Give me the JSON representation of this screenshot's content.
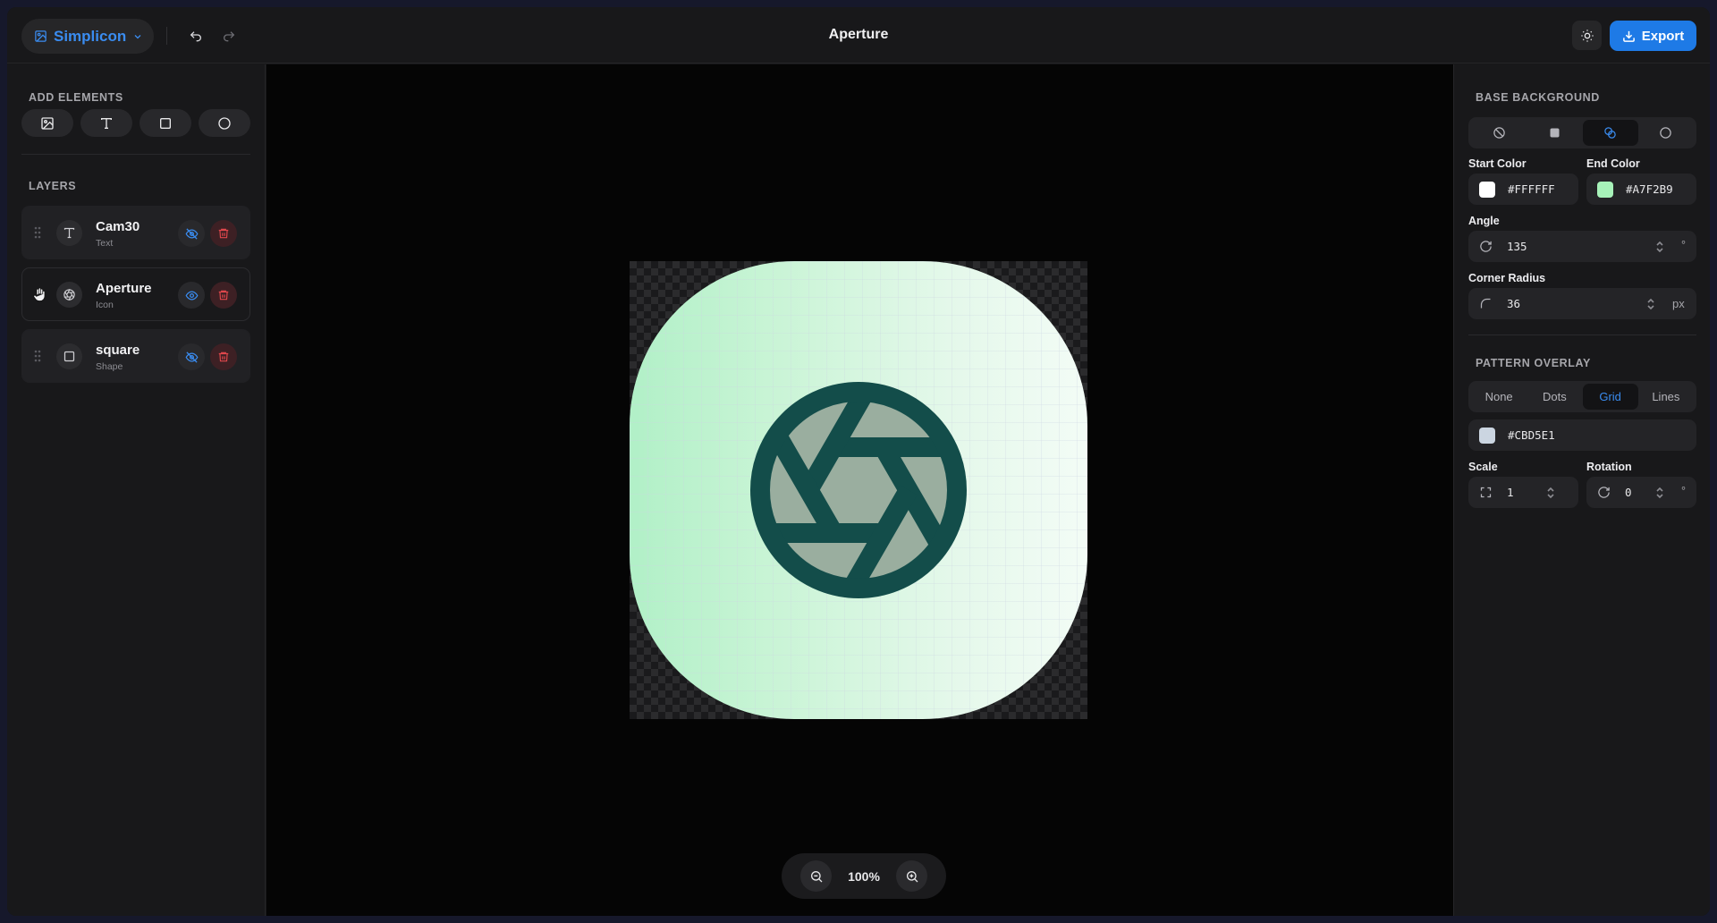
{
  "header": {
    "brand_label": "Simplicon",
    "title": "Aperture",
    "export_label": "Export",
    "icons": [
      "image-icon",
      "chevron-down-icon",
      "undo-icon",
      "redo-icon",
      "sun-icon",
      "download-icon"
    ]
  },
  "left": {
    "add_elements_title": "ADD ELEMENTS",
    "add_elements": [
      "image-icon",
      "text-icon",
      "square-icon",
      "circle-icon"
    ],
    "layers_title": "LAYERS",
    "layers": [
      {
        "name": "Cam30",
        "type": "Text",
        "icon": "text-icon",
        "visible": false,
        "selected": false
      },
      {
        "name": "Aperture",
        "type": "Icon",
        "icon": "aperture-icon",
        "visible": true,
        "selected": true
      },
      {
        "name": "square",
        "type": "Shape",
        "icon": "square-icon",
        "visible": false,
        "selected": false
      }
    ]
  },
  "canvas": {
    "zoom_label": "100%",
    "icon_color": "#134D4A"
  },
  "right": {
    "base_background_title": "BASE BACKGROUND",
    "bg_modes": [
      "none-icon",
      "solid-icon",
      "gradient-icon",
      "radial-icon"
    ],
    "bg_mode_selected": 2,
    "start_color_label": "Start Color",
    "start_color": "#FFFFFF",
    "end_color_label": "End Color",
    "end_color": "#A7F2B9",
    "angle_label": "Angle",
    "angle_value": "135",
    "angle_unit": "°",
    "corner_radius_label": "Corner Radius",
    "corner_radius_value": "36",
    "corner_radius_unit": "px",
    "pattern_overlay_title": "PATTERN OVERLAY",
    "pattern_options": [
      "None",
      "Dots",
      "Grid",
      "Lines"
    ],
    "pattern_selected": 2,
    "pattern_color": "#CBD5E1",
    "scale_label": "Scale",
    "scale_value": "1",
    "rotation_label": "Rotation",
    "rotation_value": "0",
    "rotation_unit": "°"
  },
  "colors": {
    "accent": "#1E7AE6",
    "danger": "#E0474C"
  }
}
